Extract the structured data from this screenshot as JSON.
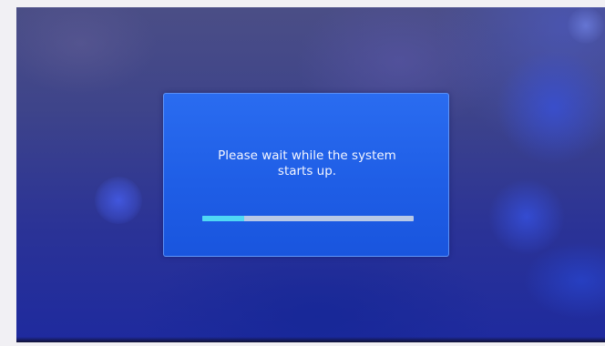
{
  "boot_screen": {
    "message": "Please wait while the system\nstarts up.",
    "progress": 0.2,
    "colors": {
      "dialog_background": "#1f5ee6",
      "progress_fill": "#4fd8f5",
      "progress_track": "#b8c8e6"
    }
  }
}
